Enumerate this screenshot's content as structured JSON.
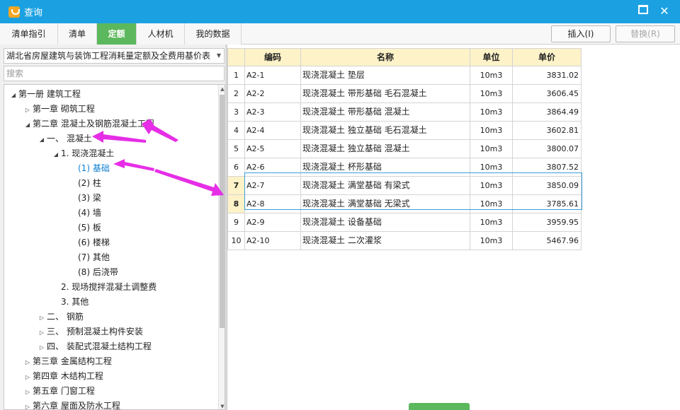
{
  "window": {
    "title": "查询",
    "app_icon": "app-logo-icon",
    "maximize_icon": "maximize-icon",
    "close_icon": "close-icon",
    "close_glyph": "✕"
  },
  "tabs": [
    {
      "label": "清单指引",
      "active": false
    },
    {
      "label": "清单",
      "active": false
    },
    {
      "label": "定额",
      "active": true
    },
    {
      "label": "人材机",
      "active": false
    },
    {
      "label": "我的数据",
      "active": false
    }
  ],
  "toolbar": {
    "insert_label": "插入(I)",
    "replace_label": "替换(R)"
  },
  "library": {
    "selected": "湖北省房屋建筑与装饰工程消耗量定额及全费用基价表",
    "arrow_glyph": "▼"
  },
  "search": {
    "placeholder": "搜索"
  },
  "tree": {
    "expanded_glyph": "◢",
    "collapsed_glyph": "▷",
    "items": [
      {
        "label": "第一册 建筑工程",
        "level": 0,
        "toggle": "expanded"
      },
      {
        "label": "第一章 砌筑工程",
        "level": 1,
        "toggle": "collapsed"
      },
      {
        "label": "第二章 混凝土及钢筋混凝土工程",
        "level": 1,
        "toggle": "expanded"
      },
      {
        "label": "一、 混凝土",
        "level": 2,
        "toggle": "expanded"
      },
      {
        "label": "1. 现浇混凝土",
        "level": 3,
        "toggle": "expanded"
      },
      {
        "label": "(1) 基础",
        "level": 4,
        "toggle": "none",
        "selected": true
      },
      {
        "label": "(2) 柱",
        "level": 4,
        "toggle": "none"
      },
      {
        "label": "(3) 梁",
        "level": 4,
        "toggle": "none"
      },
      {
        "label": "(4) 墙",
        "level": 4,
        "toggle": "none"
      },
      {
        "label": "(5) 板",
        "level": 4,
        "toggle": "none"
      },
      {
        "label": "(6) 楼梯",
        "level": 4,
        "toggle": "none"
      },
      {
        "label": "(7) 其他",
        "level": 4,
        "toggle": "none"
      },
      {
        "label": "(8) 后浇带",
        "level": 4,
        "toggle": "none"
      },
      {
        "label": "2. 现场搅拌混凝土调整费",
        "level": 3,
        "toggle": "none"
      },
      {
        "label": "3. 其他",
        "level": 3,
        "toggle": "none"
      },
      {
        "label": "二、 钢筋",
        "level": 2,
        "toggle": "collapsed"
      },
      {
        "label": "三、 预制混凝土构件安装",
        "level": 2,
        "toggle": "collapsed"
      },
      {
        "label": "四、 装配式混凝土结构工程",
        "level": 2,
        "toggle": "collapsed"
      },
      {
        "label": "第三章 金属结构工程",
        "level": 1,
        "toggle": "collapsed"
      },
      {
        "label": "第四章 木结构工程",
        "level": 1,
        "toggle": "collapsed"
      },
      {
        "label": "第五章 门窗工程",
        "level": 1,
        "toggle": "collapsed"
      },
      {
        "label": "第六章 屋面及防水工程",
        "level": 1,
        "toggle": "collapsed"
      }
    ]
  },
  "scrollbar": {
    "up_glyph": "▲",
    "down_glyph": "▼"
  },
  "grid": {
    "columns": [
      "编码",
      "名称",
      "单位",
      "单价"
    ],
    "rows": [
      {
        "no": "1",
        "code": "A2-1",
        "name": "现浇混凝土 垫层",
        "unit": "10m3",
        "price": "3831.02"
      },
      {
        "no": "2",
        "code": "A2-2",
        "name": "现浇混凝土 带形基础 毛石混凝土",
        "unit": "10m3",
        "price": "3606.45"
      },
      {
        "no": "3",
        "code": "A2-3",
        "name": "现浇混凝土 带形基础 混凝土",
        "unit": "10m3",
        "price": "3864.49"
      },
      {
        "no": "4",
        "code": "A2-4",
        "name": "现浇混凝土 独立基础 毛石混凝土",
        "unit": "10m3",
        "price": "3602.81"
      },
      {
        "no": "5",
        "code": "A2-5",
        "name": "现浇混凝土 独立基础 混凝土",
        "unit": "10m3",
        "price": "3800.07"
      },
      {
        "no": "6",
        "code": "A2-6",
        "name": "现浇混凝土 杯形基础",
        "unit": "10m3",
        "price": "3807.52"
      },
      {
        "no": "7",
        "code": "A2-7",
        "name": "现浇混凝土 满堂基础 有梁式",
        "unit": "10m3",
        "price": "3850.09",
        "highlight": true
      },
      {
        "no": "8",
        "code": "A2-8",
        "name": "现浇混凝土 满堂基础 无梁式",
        "unit": "10m3",
        "price": "3785.61",
        "highlight": true
      },
      {
        "no": "9",
        "code": "A2-9",
        "name": "现浇混凝土 设备基础",
        "unit": "10m3",
        "price": "3959.95"
      },
      {
        "no": "10",
        "code": "A2-10",
        "name": "现浇混凝土 二次灌浆",
        "unit": "10m3",
        "price": "5467.96"
      }
    ]
  },
  "colors": {
    "titlebar": "#1ba1e2",
    "active_tab": "#5cb85c",
    "header_bg": "#fdf2c8",
    "selection": "#0e7fd1",
    "annotation": "#e62ee6"
  }
}
